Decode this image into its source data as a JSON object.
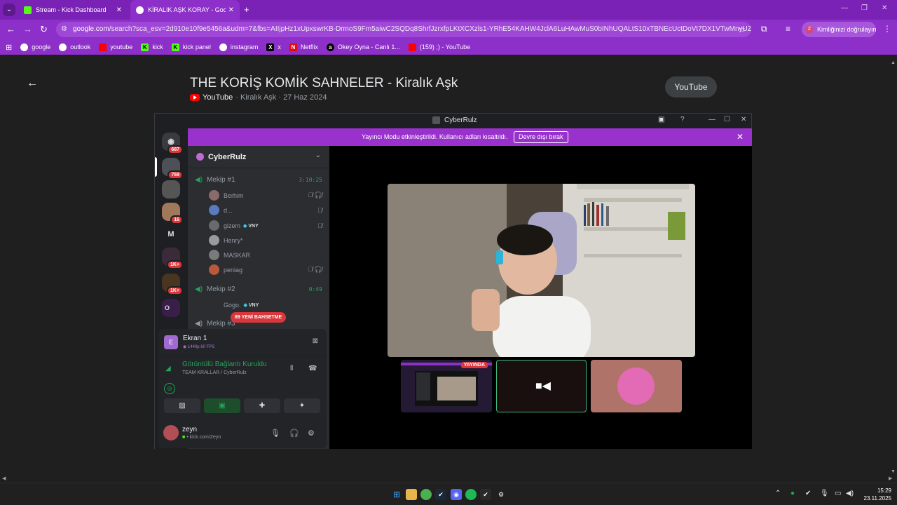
{
  "browser": {
    "tabs": [
      {
        "title": "Stream - Kick Dashboard",
        "favicon": "kick-icon",
        "color": "#53fc18"
      },
      {
        "title": "KİRALIK AŞK KORAY - Google'da",
        "favicon": "google-icon",
        "color": "#ffffff"
      }
    ],
    "new_tab": "+",
    "url_domain": "google.com",
    "url_rest": "/search?sca_esv=2d910e10f9e5456a&udm=7&fbs=AIIjpHz1xUpxswrKB-DrmoS9Fm5aiwC2SQDq8ShrfJzrxfpLKtXCXzls1-YRhE54KAHW4JclA6LuHAwMuS0bINhUQALtS10xTBNEcUctDoVt7DX1VTwMnyUZrfFVwIMFKIqW...",
    "profile_label": "Kimliğinizi doğrulayın",
    "profile_initial": "Z",
    "bookmarks": [
      {
        "label": "google",
        "icon": "google-icon",
        "color": "#ffffff"
      },
      {
        "label": "outlook",
        "icon": "outlook-icon",
        "color": "#ffffff"
      },
      {
        "label": "youtube",
        "icon": "youtube-icon",
        "color": "#ff0000"
      },
      {
        "label": "kick",
        "icon": "kick-icon",
        "color": "#53fc18"
      },
      {
        "label": "kick panel",
        "icon": "kick-icon",
        "color": "#53fc18"
      },
      {
        "label": "instagram",
        "icon": "instagram-icon",
        "color": "#ffffff"
      },
      {
        "label": "x",
        "icon": "x-icon",
        "color": "#000000"
      },
      {
        "label": "Netflix",
        "icon": "netflix-icon",
        "color": "#e50914"
      },
      {
        "label": "Okey Oyna - Canlı 1...",
        "icon": "okey-icon",
        "color": "#000000"
      },
      {
        "label": "(159) ;) - YouTube",
        "icon": "youtube-icon",
        "color": "#ff0000"
      }
    ]
  },
  "page": {
    "title": "THE KORİŞ KOMİK SAHNELER - Kiralık Aşk",
    "source": "YouTube",
    "meta": "· Kiralık Aşk · 27 Haz 2024",
    "youtube_button": "YouTube"
  },
  "discord": {
    "window_title": "CyberRulz",
    "banner_text": "Yayıncı Modu etkinleştirildi. Kullanıcı adları kısaltıldı.",
    "banner_button": "Devre dışı bırak",
    "guilds": [
      {
        "badge": "687",
        "letter": "",
        "color": "#3a3b40"
      },
      {
        "badge": "769",
        "letter": "",
        "color": "#4e5058"
      },
      {
        "badge": "",
        "letter": "",
        "color": "#555555"
      },
      {
        "badge": "16",
        "letter": "",
        "color": "#a0785a"
      },
      {
        "badge": "",
        "letter": "M",
        "color": "#1e1f22"
      },
      {
        "badge": "1K+",
        "letter": "",
        "color": "#3b2a3a"
      },
      {
        "badge": "1K+",
        "letter": "",
        "color": "#4a3520"
      },
      {
        "badge": "",
        "letter": "O",
        "color": "#3a1e4a"
      }
    ],
    "server_name": "CyberRulz",
    "channel1": {
      "name": "Mekip #1",
      "time": "3:10:25"
    },
    "channel1_users": [
      {
        "name": "Berhim",
        "tag": "",
        "icons": "🎙̸ 🎧̸",
        "color": "#8a6a6a"
      },
      {
        "name": "d...",
        "tag": "",
        "icons": "🎙̸",
        "color": "#5a7abf"
      },
      {
        "name": "gizem",
        "tag": "VNY",
        "icons": "🎙̸",
        "color": "#6a6a6a"
      },
      {
        "name": "Henry*",
        "tag": "",
        "icons": "",
        "color": "#9a9a9a"
      },
      {
        "name": "MASKAR",
        "tag": "",
        "icons": "",
        "color": "#7a7a7a"
      },
      {
        "name": "peniag",
        "tag": "",
        "icons": "🎙̸ 🎧̸",
        "color": "#b85a3a"
      }
    ],
    "channel2": {
      "name": "Mekip #2",
      "time": "0:49"
    },
    "channel2_users": [
      {
        "name": "Gogo.",
        "tag": "VNY",
        "icons": "",
        "color": "#2b2d31"
      }
    ],
    "channel3": {
      "name": "Mekip #3"
    },
    "mention_pill": "89 YENİ BAHSETME",
    "stream": {
      "title": "Ekran 1",
      "quality": "1440p 60 FPS",
      "letter": "E"
    },
    "connection": {
      "status": "Görüntülü Bağlantı Kuruldu",
      "channel": "TEAM KRALLAR / CyberRulz"
    },
    "user": {
      "name": "zeyn",
      "status": "kick.com/Zeyn"
    },
    "live_badge": "YAYINDA"
  },
  "taskbar": {
    "time": "15:29",
    "date": "23.11.2025"
  }
}
